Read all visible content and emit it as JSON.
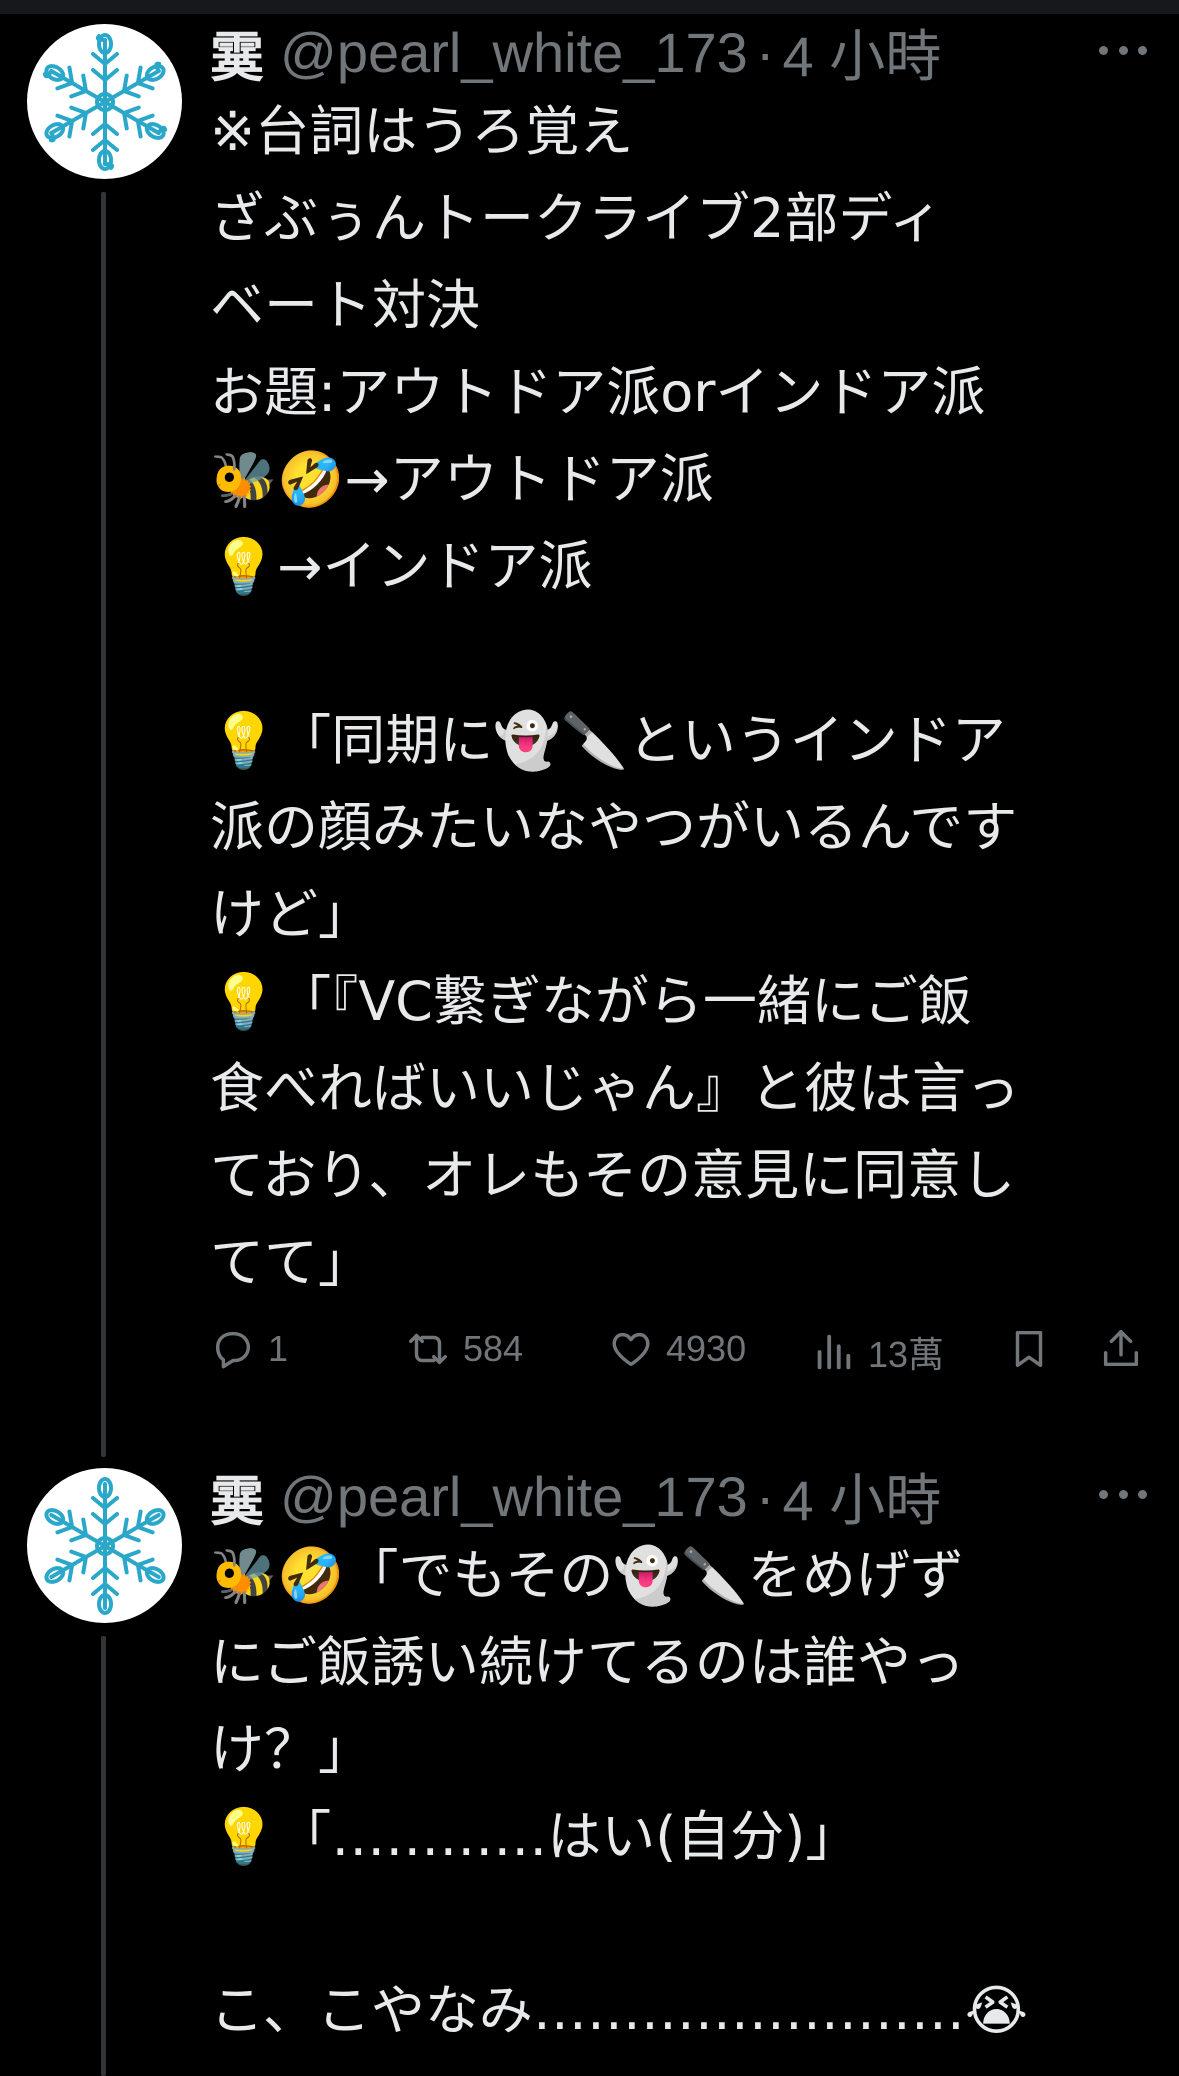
{
  "tweets": [
    {
      "author": {
        "name": "霙",
        "handle": "@pearl_white_173",
        "time": "4 小時"
      },
      "separator": "·",
      "text": "※台詞はうろ覚え\nざぶぅんトークライブ2部ディ\nベート対決\nお題:アウトドア派orインドア派\n🐝🤣→アウトドア派\n💡→インドア派\n\n💡「同期に👻🔪というインドア\n派の顔みたいなやつがいるんです\nけど」\n💡「『VC繋ぎながら一緒にご飯\n食べればいいじゃん』と彼は言っ\nており、オレもその意見に同意し\nてて」",
      "stats": {
        "replies": "1",
        "retweets": "584",
        "likes": "4930",
        "views": "13萬"
      }
    },
    {
      "author": {
        "name": "霙",
        "handle": "@pearl_white_173",
        "time": "4 小時"
      },
      "separator": "·",
      "text": "🐝🤣「でもその👻🔪をめげず\nにご飯誘い続けてるのは誰やっ\nけ？」\n💡「…………はい(自分)」\n\nこ、こやなみ……………………😭"
    }
  ],
  "colors": {
    "background": "#000000",
    "text": "#e7e9ea",
    "secondary": "#71767b",
    "avatar_snowflake": "#2aa7c9",
    "thread_line": "#333639"
  },
  "icons": [
    "snowflake-avatar",
    "more-icon",
    "reply-icon",
    "retweet-icon",
    "like-icon",
    "views-icon",
    "bookmark-icon",
    "share-icon"
  ]
}
